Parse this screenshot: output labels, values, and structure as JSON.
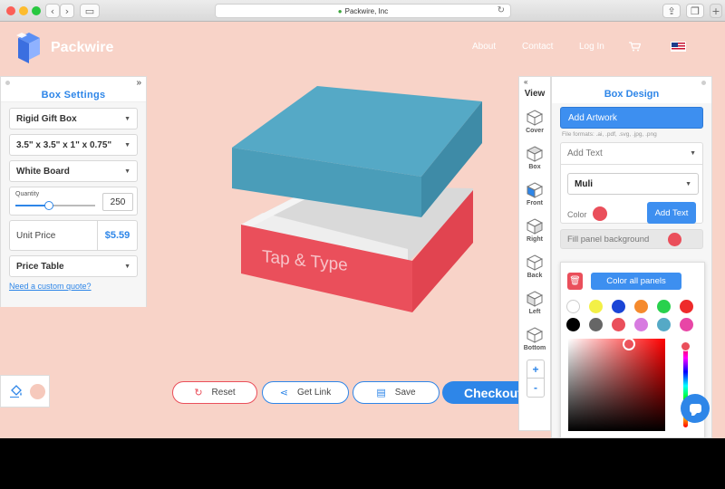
{
  "browser": {
    "url": "Packwire, Inc",
    "lock_icon": "lock-icon",
    "reload_icon": "reload-icon"
  },
  "brand": {
    "name": "Packwire",
    "logo_icon": "cube-logo-icon"
  },
  "nav": {
    "about": "About",
    "contact": "Contact",
    "login": "Log In",
    "cart_icon": "cart-icon",
    "flag_icon": "us-flag-icon"
  },
  "box_settings": {
    "title": "Box Settings",
    "collapse": "»",
    "box_type": "Rigid Gift Box",
    "dimensions": "3.5\" x 3.5\" x 1\" x 0.75\"",
    "material": "White Board",
    "quantity_label": "Quantity",
    "quantity_value": "250",
    "quantity_fraction": 0.42,
    "unit_price_label": "Unit Price",
    "unit_price_value": "$5.59",
    "price_table": "Price Table",
    "custom_quote": "Need a custom quote?"
  },
  "canvas": {
    "box_text": "Tap & Type",
    "lid_color": "#4fa6c1",
    "base_color": "#ea4f5b"
  },
  "actions": {
    "reset": "Reset",
    "get_link": "Get Link",
    "save": "Save",
    "checkout": "Checkout"
  },
  "view_panel": {
    "expand": "«",
    "title": "View",
    "items": [
      {
        "label": "Cover"
      },
      {
        "label": "Box"
      },
      {
        "label": "Front"
      },
      {
        "label": "Right"
      },
      {
        "label": "Back"
      },
      {
        "label": "Left"
      },
      {
        "label": "Bottom"
      }
    ],
    "zoom_in": "+",
    "zoom_out": "-"
  },
  "box_design": {
    "title": "Box Design",
    "add_artwork": "Add Artwork",
    "formats": "File formats: .ai, .pdf, .svg, .jpg, .png",
    "add_text_select": "Add Text",
    "font": "Muli",
    "color_label": "Color",
    "text_color": "#ea4f5b",
    "add_text_button": "Add Text",
    "fill_label": "Fill panel background",
    "fill_color": "#ea4f5b",
    "color_all": "Color all panels",
    "swatches": [
      "#ffffff",
      "#f3f046",
      "#1a45d6",
      "#f58a2d",
      "#29d14d",
      "#ee2a2a",
      "#000000",
      "#666666",
      "#ea4f5b",
      "#d77be0",
      "#55a9c6",
      "#e846a6"
    ]
  },
  "colors": {
    "accent": "#2e86e8",
    "background": "#f8d3c8",
    "paint_swatch": "#f6c9bc"
  }
}
